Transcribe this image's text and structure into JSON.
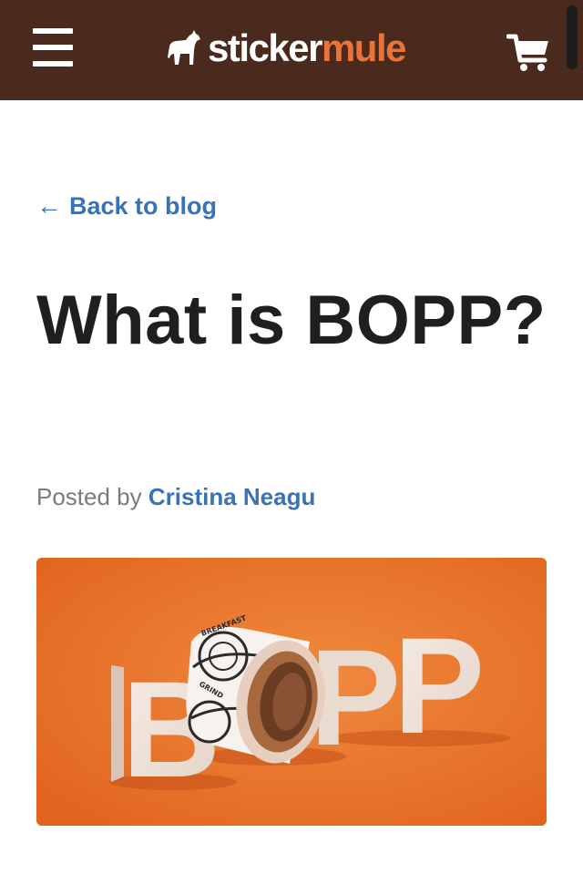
{
  "header": {
    "logo_part1": "sticker",
    "logo_part2": "mule",
    "menu_icon": "hamburger-menu-icon",
    "cart_icon": "shopping-cart-icon",
    "background": "#4a2a1d",
    "accent": "#e8743b"
  },
  "article": {
    "back_arrow": "←",
    "back_label": "Back to blog",
    "title": "What is BOPP?",
    "posted_by": "Posted by",
    "author": "Cristina Neagu"
  },
  "hero": {
    "letter_1": "B",
    "letter_2": "P",
    "letter_3": "P",
    "tape_text_1": "BREAKFAST",
    "tape_text_2": "GRIND",
    "background": "#e8732c"
  },
  "colors": {
    "link": "#3a72b6",
    "title": "#1f1f1f",
    "muted": "#7b7b7b"
  }
}
